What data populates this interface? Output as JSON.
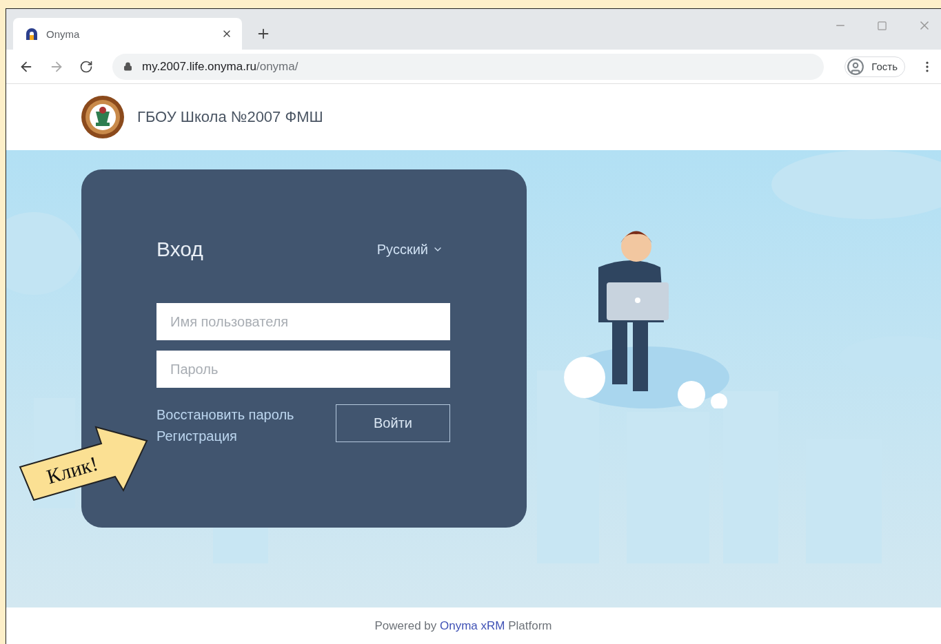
{
  "browser": {
    "tab": {
      "title": "Onyma",
      "selected": true
    },
    "address": {
      "host": "my.2007.life.onyma.ru",
      "path": "/onyma/"
    },
    "profile": "Гость"
  },
  "header": {
    "org_name": "ГБОУ Школа №2007 ФМШ"
  },
  "login": {
    "title": "Вход",
    "language": "Русский",
    "fields": [
      {
        "placeholder": "Имя пользователя"
      },
      {
        "placeholder": "Пароль"
      }
    ],
    "links": [
      "Восстановить пароль",
      "Регистрация"
    ],
    "submit": "Войти"
  },
  "callout": "Клик!",
  "footer": {
    "prefix": "Powered by",
    "brand": "Onyma xRM",
    "suffix": "Platform"
  }
}
